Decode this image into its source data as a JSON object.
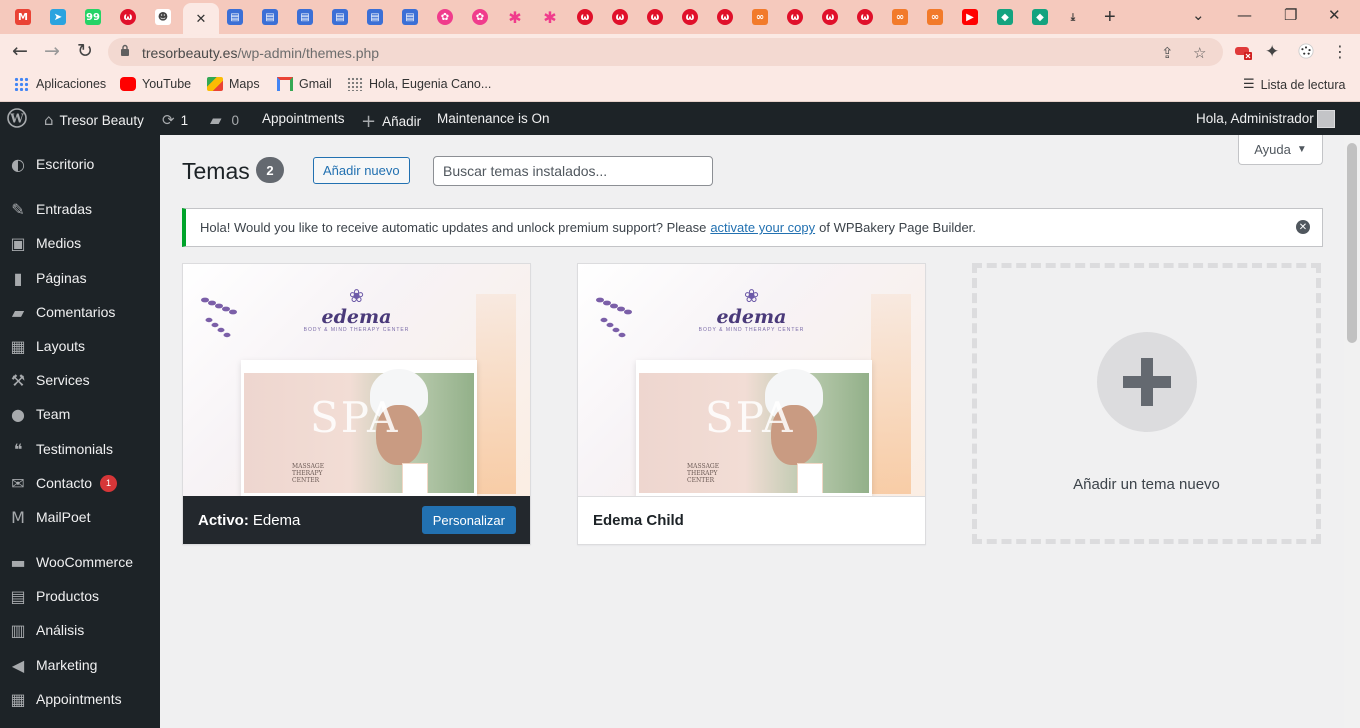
{
  "browser": {
    "tabs": [
      {
        "icon": "gmail-icon",
        "glyph": "M",
        "color": "#ea4335"
      },
      {
        "icon": "telegram-icon",
        "glyph": "➤",
        "color": "#2aa3df"
      },
      {
        "icon": "whatsapp-icon",
        "glyph": "99",
        "color": "#25d366"
      },
      {
        "icon": "w-app-icon",
        "glyph": "ω",
        "color": "#e0102a"
      },
      {
        "icon": "avatar-tab-icon",
        "glyph": "☻",
        "color": "#444444"
      },
      {
        "icon": "active-tab-close-icon",
        "glyph": "✕",
        "color": "#333333"
      },
      {
        "icon": "doc-icon",
        "glyph": "▤",
        "color": "#3b6fd6"
      },
      {
        "icon": "doc-icon",
        "glyph": "▤",
        "color": "#3b6fd6"
      },
      {
        "icon": "doc-icon",
        "glyph": "▤",
        "color": "#3b6fd6"
      },
      {
        "icon": "doc-icon",
        "glyph": "▤",
        "color": "#3b6fd6"
      },
      {
        "icon": "doc-icon",
        "glyph": "▤",
        "color": "#3b6fd6"
      },
      {
        "icon": "doc-icon",
        "glyph": "▤",
        "color": "#3b6fd6"
      },
      {
        "icon": "flower-icon",
        "glyph": "✿",
        "color": "#f03c8c"
      },
      {
        "icon": "flower-icon",
        "glyph": "✿",
        "color": "#f03c8c"
      },
      {
        "icon": "asterisk-icon",
        "glyph": "✱",
        "color": "#f03c8c"
      },
      {
        "icon": "asterisk-icon",
        "glyph": "✱",
        "color": "#f03c8c"
      },
      {
        "icon": "w-app-icon",
        "glyph": "ω",
        "color": "#e0102a"
      },
      {
        "icon": "w-app-icon",
        "glyph": "ω",
        "color": "#e0102a"
      },
      {
        "icon": "w-app-icon",
        "glyph": "ω",
        "color": "#e0102a"
      },
      {
        "icon": "w-app-icon",
        "glyph": "ω",
        "color": "#e0102a"
      },
      {
        "icon": "w-app-icon",
        "glyph": "ω",
        "color": "#e0102a"
      },
      {
        "icon": "link-icon",
        "glyph": "∞",
        "color": "#f27a2a"
      },
      {
        "icon": "w-app-icon",
        "glyph": "ω",
        "color": "#e0102a"
      },
      {
        "icon": "w-app-icon",
        "glyph": "ω",
        "color": "#e0102a"
      },
      {
        "icon": "w-app-icon",
        "glyph": "ω",
        "color": "#e0102a"
      },
      {
        "icon": "link-icon",
        "glyph": "∞",
        "color": "#f27a2a"
      },
      {
        "icon": "link-icon",
        "glyph": "∞",
        "color": "#f27a2a"
      },
      {
        "icon": "youtube-icon",
        "glyph": "▶",
        "color": "#ff0000"
      },
      {
        "icon": "leaf-icon",
        "glyph": "◆",
        "color": "#14a37f"
      },
      {
        "icon": "leaf-icon",
        "glyph": "◆",
        "color": "#14a37f"
      },
      {
        "icon": "download-icon",
        "glyph": "⤓",
        "color": "#333333"
      }
    ],
    "new_tab": "+",
    "url_domain": "tresorbeauty.es",
    "url_path": "/wp-admin/themes.php",
    "bookmarks": [
      {
        "label": "Aplicaciones",
        "icon": "apps-grid-icon",
        "color": "#e94235"
      },
      {
        "label": "YouTube",
        "icon": "youtube-icon",
        "color": "#ff0000"
      },
      {
        "label": "Maps",
        "icon": "maps-icon",
        "color": "#34a853"
      },
      {
        "label": "Gmail",
        "icon": "gmail-icon",
        "color": "#ea4335"
      },
      {
        "label": "Hola, Eugenia Cano...",
        "icon": "dots-icon",
        "color": "#666666"
      }
    ],
    "reading_list": "Lista de lectura"
  },
  "adminbar": {
    "site_name": "Tresor Beauty",
    "updates": "1",
    "comments": "0",
    "appointments": "Appointments",
    "add": "Añadir",
    "maintenance": "Maintenance is On",
    "greeting": "Hola, Administrador"
  },
  "sidebar": {
    "items": [
      {
        "label": "Escritorio",
        "icon": "dashboard-icon",
        "glyph": "◐"
      },
      {
        "label": "Entradas",
        "icon": "pin-icon",
        "glyph": "✎"
      },
      {
        "label": "Medios",
        "icon": "media-icon",
        "glyph": "▣"
      },
      {
        "label": "Páginas",
        "icon": "pages-icon",
        "glyph": "▮"
      },
      {
        "label": "Comentarios",
        "icon": "comments-icon",
        "glyph": "▰"
      },
      {
        "label": "Layouts",
        "icon": "layouts-icon",
        "glyph": "▦"
      },
      {
        "label": "Services",
        "icon": "wrench-icon",
        "glyph": "⚒"
      },
      {
        "label": "Team",
        "icon": "person-icon",
        "glyph": "●"
      },
      {
        "label": "Testimonials",
        "icon": "speech-icon",
        "glyph": "❝"
      },
      {
        "label": "Contacto",
        "icon": "mail-icon",
        "glyph": "✉",
        "badge": "1"
      },
      {
        "label": "MailPoet",
        "icon": "mailpoet-icon",
        "glyph": "M"
      },
      {
        "label": "WooCommerce",
        "icon": "woo-icon",
        "glyph": "▬"
      },
      {
        "label": "Productos",
        "icon": "archive-icon",
        "glyph": "▤"
      },
      {
        "label": "Análisis",
        "icon": "bar-chart-icon",
        "glyph": "▥"
      },
      {
        "label": "Marketing",
        "icon": "megaphone-icon",
        "glyph": "◀"
      },
      {
        "label": "Appointments",
        "icon": "calendar-icon",
        "glyph": "▦"
      }
    ]
  },
  "main": {
    "help": "Ayuda",
    "title": "Temas",
    "count": "2",
    "add_new": "Añadir nuevo",
    "search_placeholder": "Buscar temas instalados...",
    "notice": {
      "before": "Hola! Would you like to receive automatic updates and unlock premium support? Please",
      "link": "activate your copy",
      "after": "of WPBakery Page Builder."
    },
    "themes": [
      {
        "active_label": "Activo:",
        "name": "Edema",
        "button": "Personalizar"
      },
      {
        "name": "Edema Child"
      }
    ],
    "screenshot": {
      "logo": "edema",
      "tagline": "BODY & MIND THERAPY CENTER",
      "headline": "SPA",
      "caption": "MASSAGE THERAPY CENTER"
    },
    "add_theme": "Añadir un tema nuevo"
  }
}
